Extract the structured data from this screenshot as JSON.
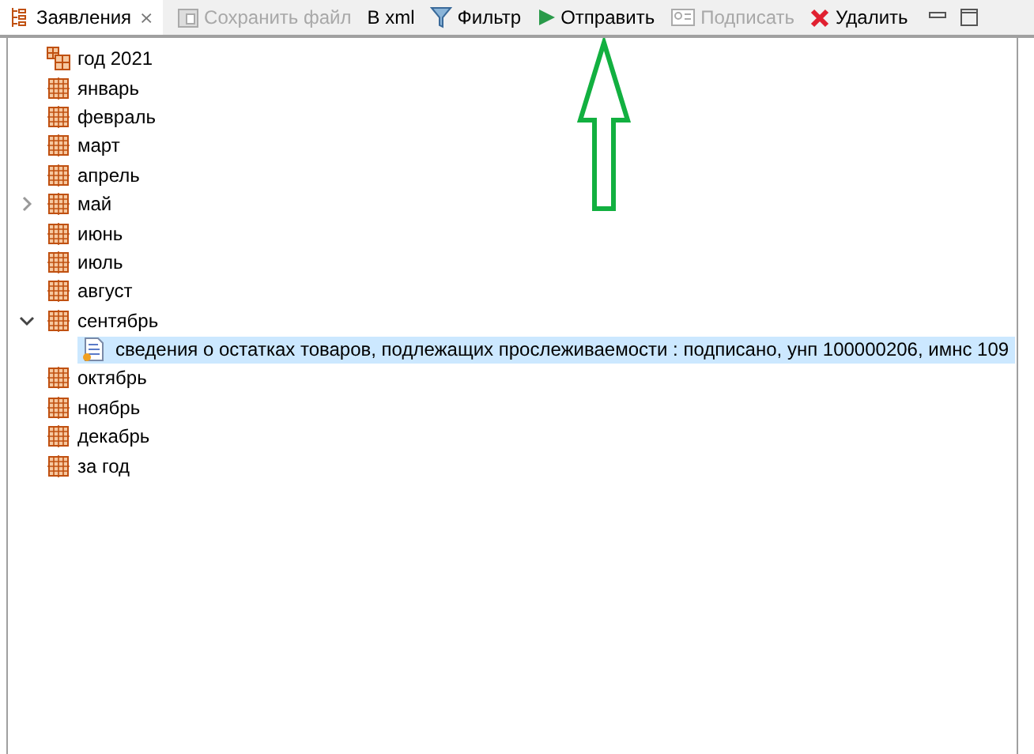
{
  "view_tab": {
    "label": "Заявления",
    "close": "⨯",
    "selected": true
  },
  "toolbar": [
    {
      "kind": "save",
      "label": "Сохранить файл",
      "disabled": true
    },
    {
      "kind": "plain",
      "label": "В xml",
      "disabled": false
    },
    {
      "kind": "filter",
      "label": "Фильтр",
      "disabled": false
    },
    {
      "kind": "send",
      "label": "Отправить",
      "disabled": false
    },
    {
      "kind": "sign",
      "label": "Подписать",
      "disabled": true
    },
    {
      "kind": "delete",
      "label": "Удалить",
      "disabled": false
    }
  ],
  "tree": [
    {
      "kind": "year",
      "label": "год 2021",
      "has_children": false
    },
    {
      "kind": "month",
      "label": "январь",
      "has_children": false
    },
    {
      "kind": "month",
      "label": "февраль",
      "has_children": false
    },
    {
      "kind": "month",
      "label": "март",
      "has_children": false
    },
    {
      "kind": "month",
      "label": "апрель",
      "has_children": false
    },
    {
      "kind": "month",
      "label": "май",
      "has_children": true,
      "expanded": false
    },
    {
      "kind": "month",
      "label": "июнь",
      "has_children": false
    },
    {
      "kind": "month",
      "label": "июль",
      "has_children": false
    },
    {
      "kind": "month",
      "label": "август",
      "has_children": false
    },
    {
      "kind": "month",
      "label": "сентябрь",
      "has_children": true,
      "expanded": true,
      "children": [
        {
          "kind": "document",
          "label": "сведения о остатках товаров, подлежащих прослеживаемости : подписано, унп 100000206, имнс 109",
          "selected": true
        }
      ]
    },
    {
      "kind": "month",
      "label": "октябрь",
      "has_children": false
    },
    {
      "kind": "month",
      "label": "ноябрь",
      "has_children": false
    },
    {
      "kind": "month",
      "label": "декабрь",
      "has_children": false
    },
    {
      "kind": "month",
      "label": "за год",
      "has_children": false
    }
  ]
}
